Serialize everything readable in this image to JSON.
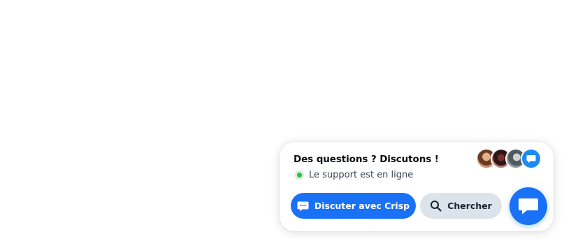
{
  "widget": {
    "title": "Des questions ? Discutons !",
    "status_text": "Le support est en ligne",
    "status_color": "#2ac437",
    "avatars": [
      "operator-avatar",
      "operator-avatar",
      "operator-avatar",
      "chat-bubble-icon"
    ]
  },
  "buttons": {
    "chat_label": "Discuter avec Crisp",
    "chat_icon": "chat-bubble-icon",
    "search_label": "Chercher",
    "search_icon": "search-icon"
  },
  "launcher": {
    "icon": "chat-bubble-icon"
  },
  "colors": {
    "accent": "#1972f5",
    "secondary_button": "#dde3ea",
    "online": "#2ac437"
  }
}
